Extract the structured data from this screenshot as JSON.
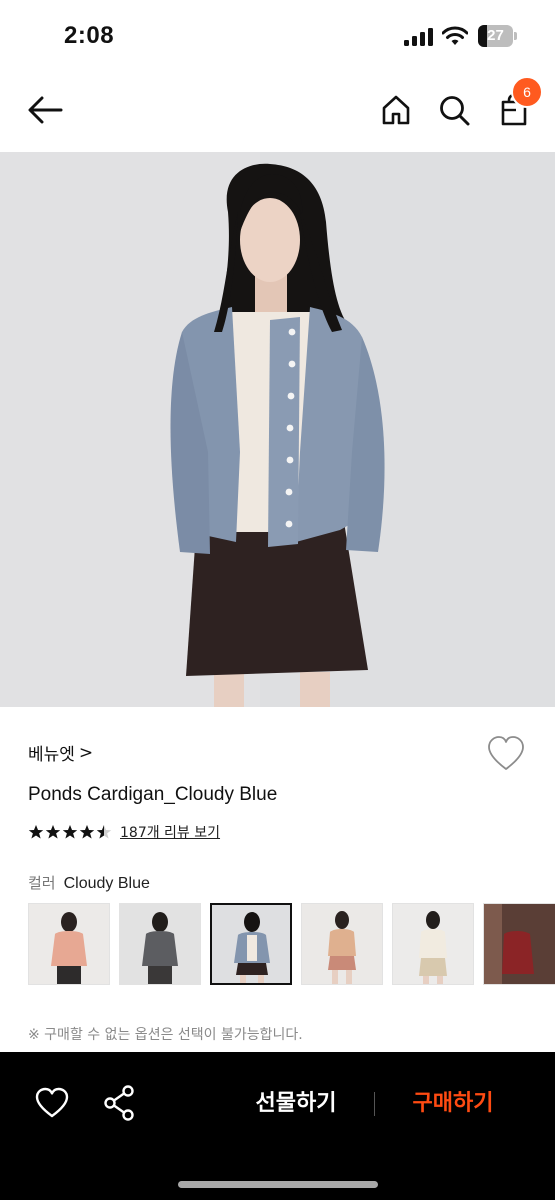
{
  "status_bar": {
    "time": "2:08",
    "battery_level": "27",
    "battery_fraction": 0.27
  },
  "header": {
    "back_icon": "arrow-left-icon",
    "home_icon": "home-icon",
    "search_icon": "search-icon",
    "cart_icon": "shopping-bag-icon",
    "cart_count": "6"
  },
  "product": {
    "brand": "베뉴엣",
    "brand_chevron": ">",
    "title": "Ponds Cardigan_Cloudy Blue",
    "rating": 4.5,
    "review_link": "187개 리뷰 보기",
    "color_label": "컬러",
    "color_value": "Cloudy Blue",
    "notice": "※ 구매할 수 없는 옵션은 선택이 불가능합니다."
  },
  "swatches": [
    {
      "name": "pink",
      "selected": false
    },
    {
      "name": "charcoal",
      "selected": false
    },
    {
      "name": "cloudy-blue",
      "selected": true
    },
    {
      "name": "apricot",
      "selected": false
    },
    {
      "name": "ivory",
      "selected": false
    },
    {
      "name": "burgundy",
      "selected": false
    }
  ],
  "bottom_bar": {
    "wish_icon": "heart-icon",
    "share_icon": "share-icon",
    "gift_label": "선물하기",
    "buy_label": "구매하기"
  },
  "colors": {
    "accent": "#ff4b12",
    "badge": "#ff5a1f",
    "bottom_bar_bg": "#000000"
  }
}
